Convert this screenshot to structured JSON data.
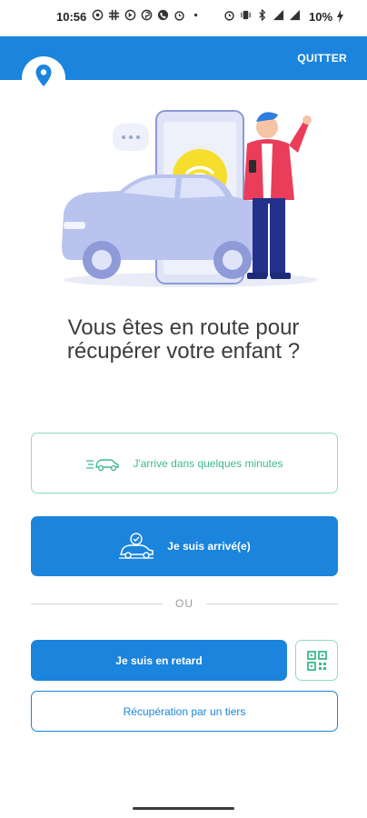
{
  "status_bar": {
    "time": "10:56",
    "battery": "10%",
    "left_icons": [
      "whatsapp-icon",
      "slack-icon",
      "app-icon",
      "pinterest-icon",
      "phone-icon",
      "alarm-icon",
      "dot-icon"
    ],
    "right_icons": [
      "alarm-icon",
      "vibrate-icon",
      "bluetooth-icon",
      "signal-icon",
      "wifi-icon"
    ]
  },
  "header": {
    "quit_label": "QUITTER",
    "background": "#1b84dd"
  },
  "main": {
    "question": "Vous êtes en route pour récupérer votre enfant ?",
    "btn_minutes": "J'arrive dans quelques minutes",
    "btn_arrived": "Je suis arrivé(e)",
    "divider": "OU",
    "btn_late": "Je suis en retard",
    "btn_third_party": "Récupération par un tiers"
  },
  "colors": {
    "primary": "#1b84dd",
    "accent_green": "#3db98b",
    "text": "#3c3c3c"
  }
}
